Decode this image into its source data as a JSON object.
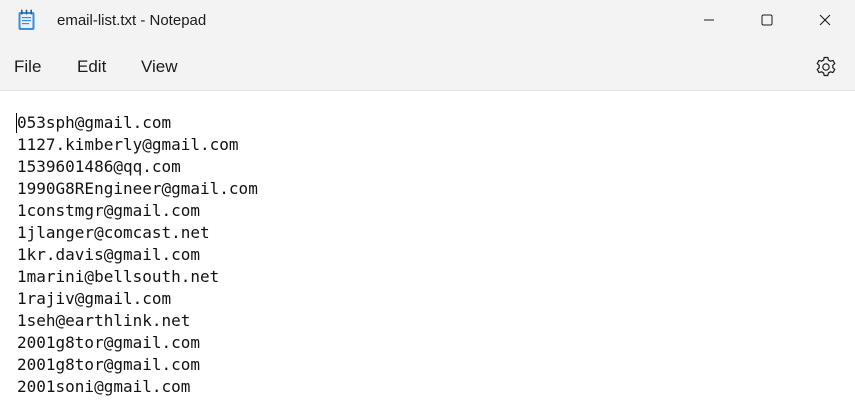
{
  "window": {
    "title": "email-list.txt - Notepad",
    "app_icon": "notepad-icon",
    "controls": [
      "minimize-icon",
      "maximize-icon",
      "close-icon"
    ]
  },
  "menu": {
    "file": "File",
    "edit": "Edit",
    "view": "View",
    "settings_icon": "gear-icon"
  },
  "editor": {
    "lines": [
      "053sph@gmail.com",
      "1127.kimberly@gmail.com",
      "1539601486@qq.com",
      "1990G8REngineer@gmail.com",
      "1constmgr@gmail.com",
      "1jlanger@comcast.net",
      "1kr.davis@gmail.com",
      "1marini@bellsouth.net",
      "1rajiv@gmail.com",
      "1seh@earthlink.net",
      "2001g8tor@gmail.com",
      "2001g8tor@gmail.com",
      "2001soni@gmail.com"
    ]
  }
}
